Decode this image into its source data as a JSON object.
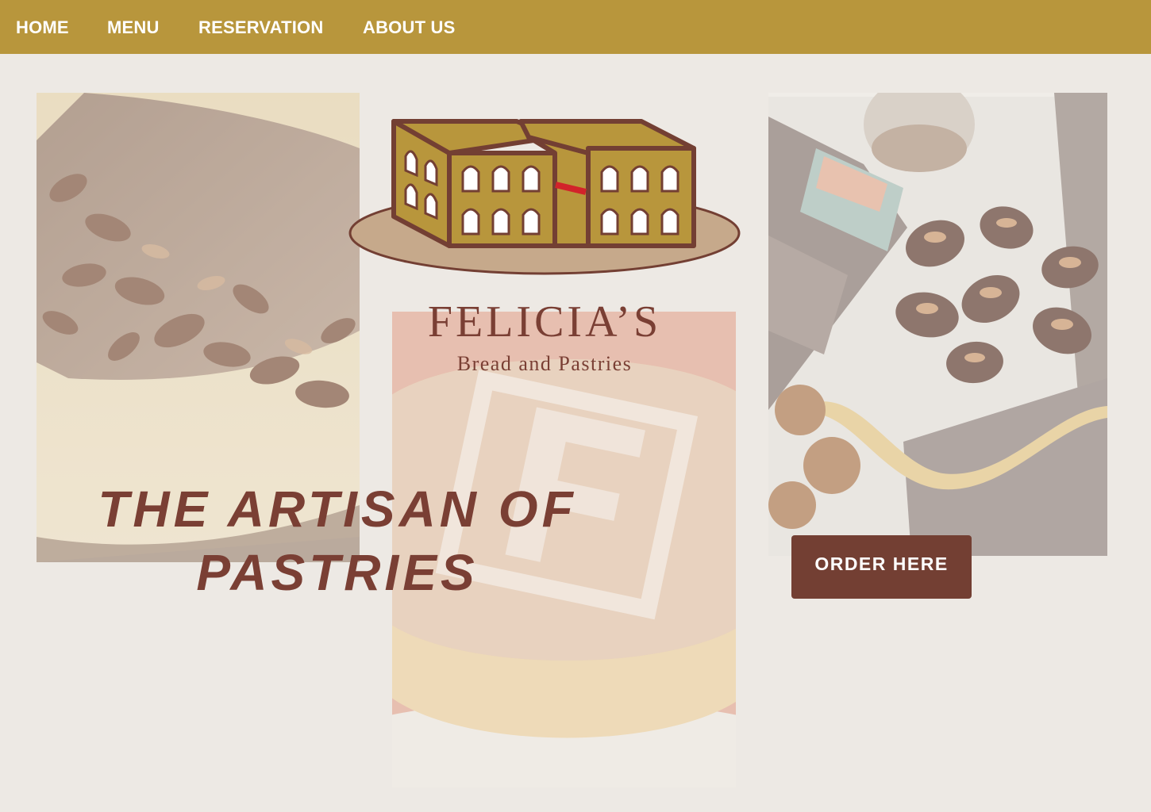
{
  "nav": {
    "items": [
      {
        "label": "HOME"
      },
      {
        "label": "MENU"
      },
      {
        "label": "RESERVATION"
      },
      {
        "label": "ABOUT US"
      }
    ]
  },
  "brand": {
    "name": "FELICIA’S",
    "tagline": "Bread and Pastries"
  },
  "hero": {
    "headline": "THE ARTISAN OF PASTRIES",
    "cta_label": "ORDER HERE"
  },
  "colors": {
    "nav_bg": "#b8963c",
    "page_bg": "#ede9e4",
    "brand_brown": "#7a3f34",
    "cta_bg": "#733f33"
  },
  "icons": {
    "logo": "bakery-building-logo"
  }
}
